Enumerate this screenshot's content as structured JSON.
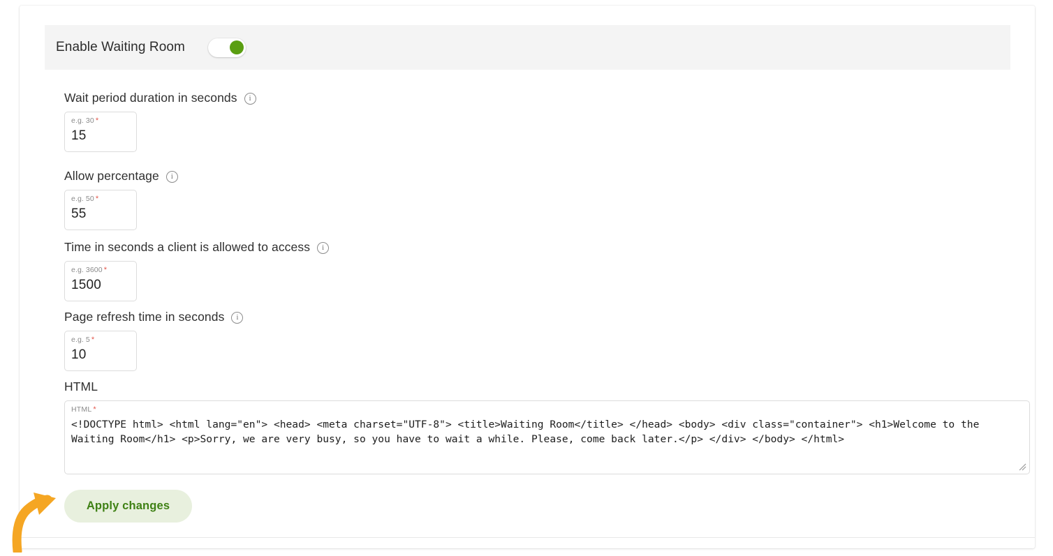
{
  "toggle_section": {
    "label": "Enable Waiting Room",
    "state": "on",
    "knob_color": "#5a9e11",
    "band_color": "#f4f4f4"
  },
  "fields": [
    {
      "label": "Wait period duration in seconds",
      "info_icon": "info-icon",
      "placeholder": "e.g. 30",
      "required_mark": "*",
      "value": "15"
    },
    {
      "label": "Allow percentage",
      "info_icon": "info-icon",
      "placeholder": "e.g. 50",
      "required_mark": "*",
      "value": "55"
    },
    {
      "label": "Time in seconds a client is allowed to access",
      "info_icon": "info-icon",
      "placeholder": "e.g. 3600",
      "required_mark": "*",
      "value": "1500"
    },
    {
      "label": "Page refresh time in seconds",
      "info_icon": "info-icon",
      "placeholder": "e.g. 5",
      "required_mark": "*",
      "value": "10"
    }
  ],
  "html_section": {
    "heading": "HTML",
    "placeholder": "HTML",
    "required_mark": "*",
    "value": "<!DOCTYPE html> <html lang=\"en\"> <head> <meta charset=\"UTF-8\"> <title>Waiting Room</title> </head> <body> <div class=\"container\"> <h1>Welcome to the Waiting Room</h1> <p>Sorry, we are very busy, so you have to wait a while. Please, come back later.</p> </div> </body> </html>",
    "resize_handle": "resize-grip-icon"
  },
  "actions": {
    "apply_label": "Apply changes",
    "apply_bg": "#e8f0de",
    "apply_text_color": "#3f8115"
  },
  "annotation": {
    "arrow_icon": "curved-arrow-icon",
    "arrow_color": "#f5a623"
  }
}
